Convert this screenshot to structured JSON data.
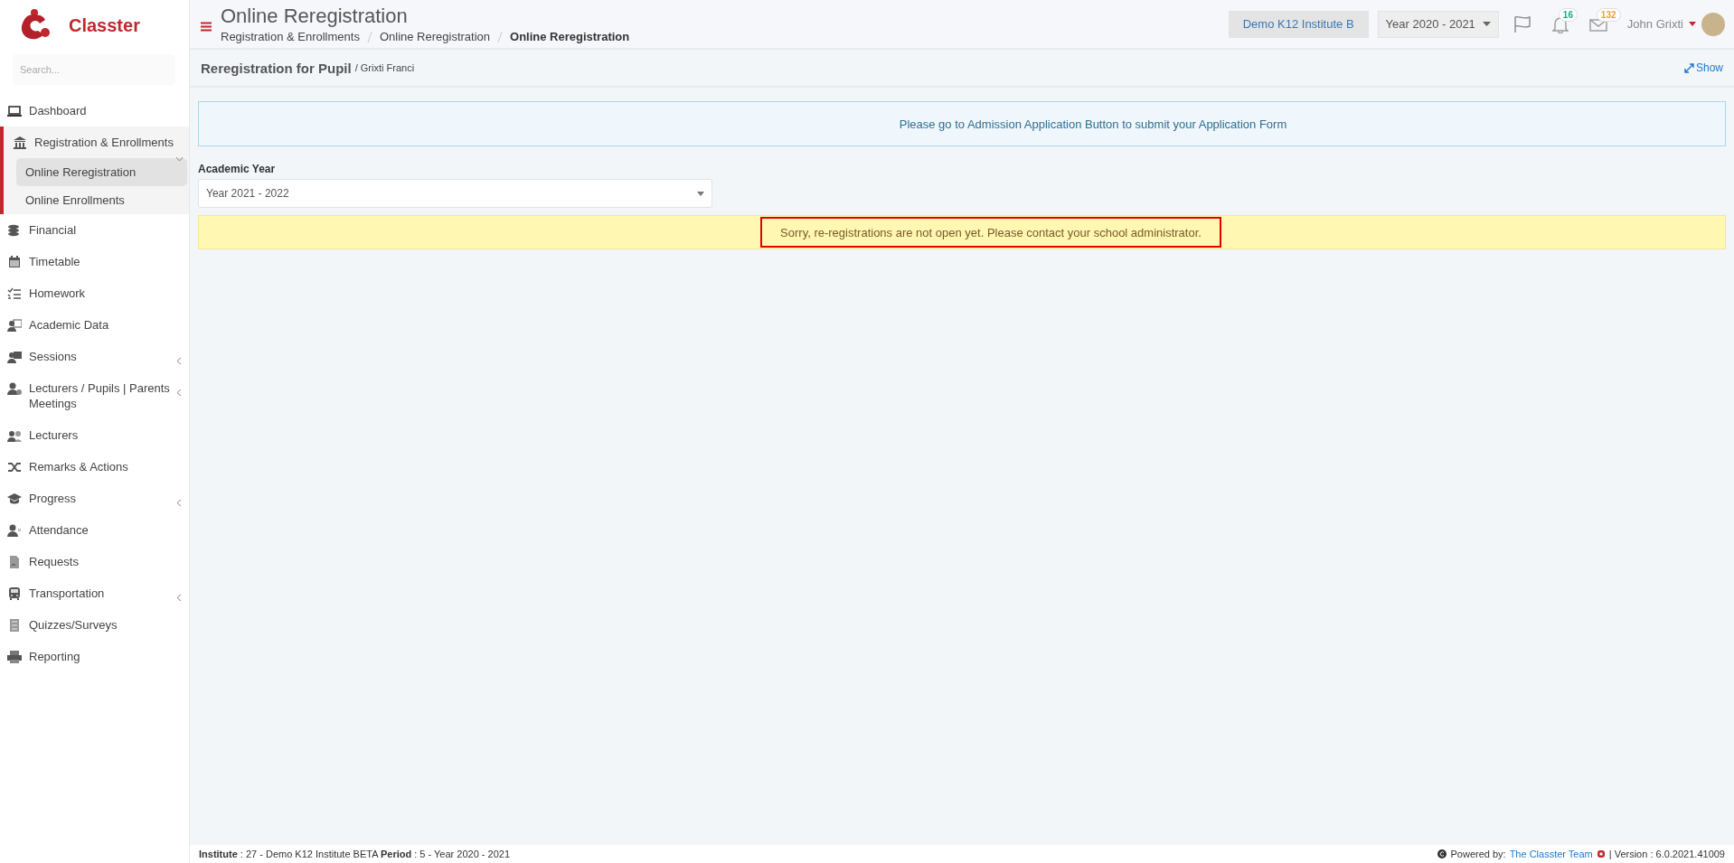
{
  "sidebar": {
    "brand": "Classter",
    "search": {
      "placeholder": "Search..."
    },
    "items": [
      {
        "label": "Dashboard",
        "has_submenu": false,
        "expanded": false
      },
      {
        "label": "Registration & Enrollments",
        "has_submenu": true,
        "expanded": true,
        "children": [
          {
            "label": "Online Reregistration",
            "selected": true
          },
          {
            "label": "Online Enrollments",
            "selected": false
          }
        ]
      },
      {
        "label": "Financial",
        "has_submenu": false,
        "expanded": false
      },
      {
        "label": "Timetable",
        "has_submenu": false,
        "expanded": false
      },
      {
        "label": "Homework",
        "has_submenu": false,
        "expanded": false
      },
      {
        "label": "Academic Data",
        "has_submenu": false,
        "expanded": false
      },
      {
        "label": "Sessions",
        "has_submenu": true,
        "expanded": false
      },
      {
        "label": "Lecturers / Pupils | Parents Meetings",
        "has_submenu": true,
        "expanded": false
      },
      {
        "label": "Lecturers",
        "has_submenu": false,
        "expanded": false
      },
      {
        "label": "Remarks & Actions",
        "has_submenu": false,
        "expanded": false
      },
      {
        "label": "Progress",
        "has_submenu": true,
        "expanded": false
      },
      {
        "label": "Attendance",
        "has_submenu": false,
        "expanded": false
      },
      {
        "label": "Requests",
        "has_submenu": false,
        "expanded": false
      },
      {
        "label": "Transportation",
        "has_submenu": true,
        "expanded": false
      },
      {
        "label": "Quizzes/Surveys",
        "has_submenu": false,
        "expanded": false
      },
      {
        "label": "Reporting",
        "has_submenu": false,
        "expanded": false
      }
    ]
  },
  "header": {
    "title": "Online Reregistration",
    "breadcrumbs": [
      "Registration & Enrollments",
      "Online Reregistration",
      "Online Reregistration"
    ],
    "institute": "Demo K12 Institute B",
    "year": "Year 2020 - 2021",
    "notifications": "16",
    "messages": "132",
    "user": "John Grixti"
  },
  "page": {
    "heading": "Reregistration for Pupil",
    "subheading": "/ Grixti Franci",
    "show": "Show"
  },
  "info": "Please go to Admission Application Button to submit your Application Form",
  "academic_year": {
    "label": "Academic Year",
    "value": "Year 2021 - 2022"
  },
  "warning": "Sorry, re-registrations are not open yet. Please contact your school administrator.",
  "footer": {
    "left": "**Institute** : 27 - Demo K12 Institute BETA **Period** : 5 - Year 2020 - 2021",
    "powered": "Powered by:",
    "link": "The Classter Team",
    "version": "| Version : 6.0.2021.41009"
  }
}
